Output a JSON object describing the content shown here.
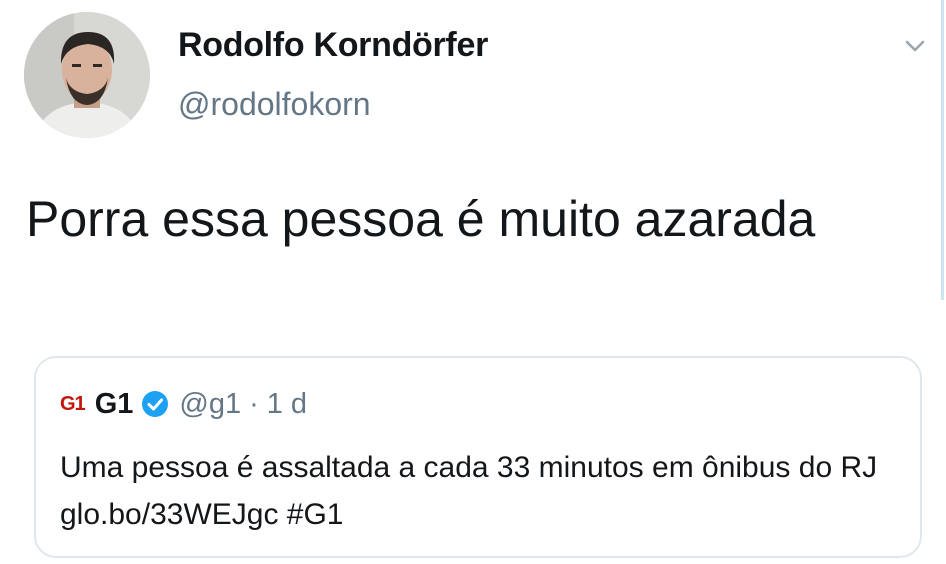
{
  "tweet": {
    "author_name": "Rodolfo Korndörfer",
    "author_handle": "@rodolfokorn",
    "text": "Porra essa pessoa é muito azarada"
  },
  "quoted_tweet": {
    "logo": "G1",
    "name": "G1",
    "handle": "@g1",
    "separator": "·",
    "time": "1 d",
    "text": "Uma pessoa é assaltada a cada 33 minutos em ônibus do RJ glo.bo/33WEJgc #G1"
  },
  "icons": {
    "menu": "chevron-down-icon",
    "verified": "verified-badge-icon"
  },
  "colors": {
    "text_primary": "#14171a",
    "text_secondary": "#657786",
    "card_border": "#e1e8ed",
    "verified_blue": "#1da1f2",
    "g1_red": "#c4170c"
  }
}
